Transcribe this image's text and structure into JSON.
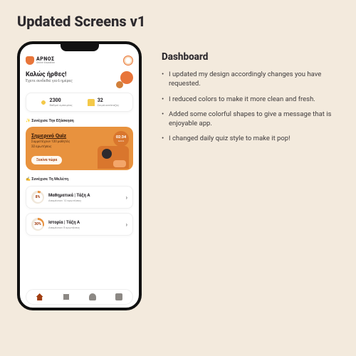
{
  "page_title": "Updated Screens v1",
  "phone": {
    "brand_name": "ΑΡΝΟΣ",
    "brand_sub": "Online Education",
    "greeting": "Καλώς ήρθες!",
    "greeting_sub": "Έχετε συνδεθεί για 6 ημέρες",
    "stats": {
      "points_value": "2300",
      "points_label": "Βαθμοί εμπειρίας",
      "rank_value": "32",
      "rank_label": "Σειρά κατάταξης"
    },
    "section_practice": "✨ Συνέχισε Την Εξάσκηση",
    "quiz": {
      "title": "Σημερινό Quiz",
      "line1": "Συμμετέχουν 120 μαθητές",
      "line2": "32 ερωτήσεις",
      "cta": "Ξεκίνα τώρα",
      "timer_value": "02:34",
      "timer_label": "λεπτά"
    },
    "section_study": "✍️ Συνέχισε Τη Μελέτη",
    "study": [
      {
        "pct": "8%",
        "pct_css": "8%",
        "pct_text": "8%",
        "title": "Μαθηματικά | Τάξη Α",
        "sub": "Απομένουν 12 ερωτήσεις"
      },
      {
        "pct": "30%",
        "pct_css": "30%",
        "pct_text": "30%",
        "title": "Ιστορία | Τάξη Α",
        "sub": "Απομένουν 5 ερωτήσεις"
      }
    ]
  },
  "desc": {
    "heading": "Dashboard",
    "bullets": [
      "I updated my design accordingly changes you have requested.",
      "I reduced colors to make it more clean and fresh.",
      "Added some colorful shapes to give a message that is enjoyable app.",
      "I changed daily quiz style to make it pop!"
    ]
  }
}
